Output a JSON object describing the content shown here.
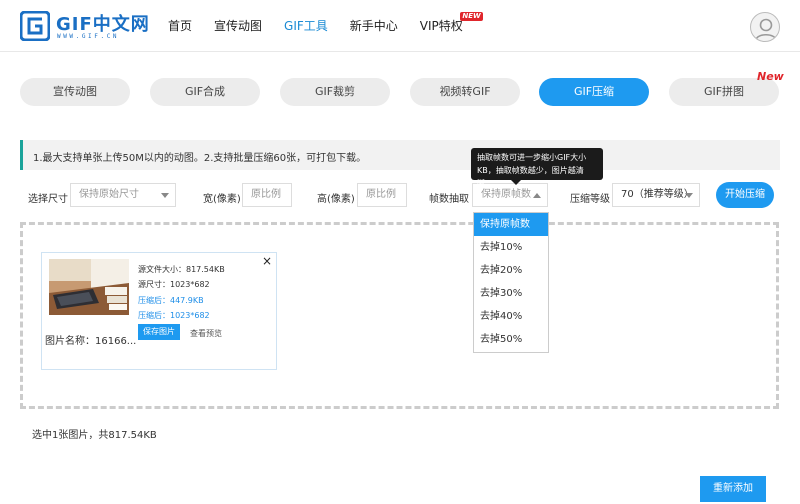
{
  "header": {
    "logo_text": "GIF中文网",
    "logo_sub": "WWW.GIF.CN",
    "nav": [
      {
        "label": "首页"
      },
      {
        "label": "宣传动图"
      },
      {
        "label": "GIF工具"
      },
      {
        "label": "新手中心"
      },
      {
        "label": "VIP特权"
      }
    ],
    "vip_badge": "NEW"
  },
  "tabs": [
    {
      "label": "宣传动图"
    },
    {
      "label": "GIF合成"
    },
    {
      "label": "GIF裁剪"
    },
    {
      "label": "视频转GIF"
    },
    {
      "label": "GIF压缩"
    },
    {
      "label": "GIF拼图"
    }
  ],
  "tabs_new_tag": "New",
  "notice": "1.最大支持单张上传50M以内的动图。2.支持批量压缩60张，可打包下载。",
  "tooltip": {
    "line1": "抽取帧数可进一步缩小GIF大小",
    "line2": "KB，抽取帧数越少，图片越清晰。"
  },
  "options": {
    "size_label": "选择尺寸",
    "size_value": "保持原始尺寸",
    "width_label": "宽(像素)",
    "width_placeholder": "原比例",
    "height_label": "高(像素)",
    "height_placeholder": "原比例",
    "frame_label": "帧数抽取",
    "frame_value": "保持原帧数",
    "level_label": "压缩等级",
    "level_value": "70（推荐等级）",
    "start_button": "开始压缩"
  },
  "frame_options": [
    "保持原帧数",
    "去掉10%",
    "去掉20%",
    "去掉30%",
    "去掉40%",
    "去掉50%"
  ],
  "card": {
    "source_size": "源文件大小：817.54KB",
    "source_dims": "源尺寸：1023*682",
    "compressed_size": "压缩后：447.9KB",
    "compressed_dims": "压缩后：1023*682",
    "save_button": "保存图片",
    "preview_button": "查看预览",
    "filename": "图片名称：16166...",
    "close": "×"
  },
  "summary": "选中1张图片，共817.54KB",
  "readd_button": "重新添加"
}
